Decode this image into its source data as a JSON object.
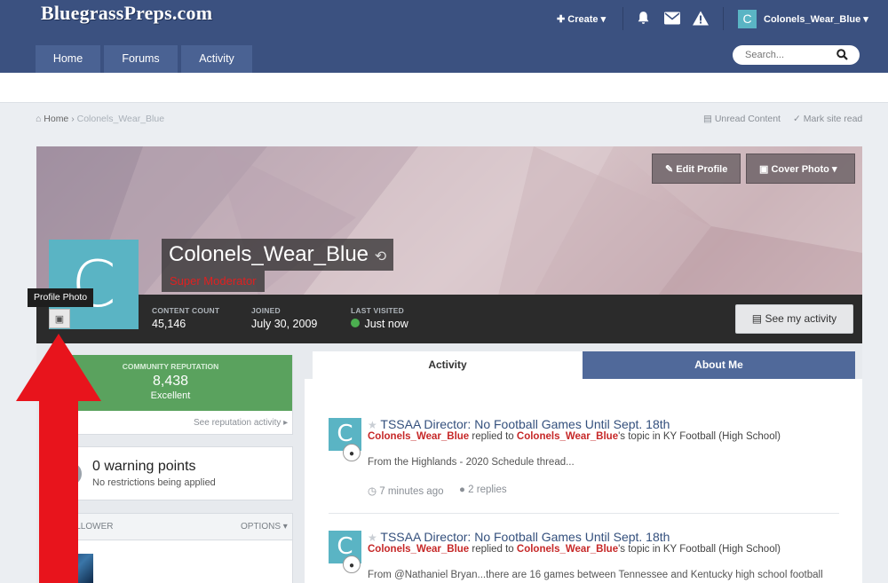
{
  "header": {
    "logo": "BluegrassPreps.com",
    "create_label": "Create",
    "username": "Colonels_Wear_Blue",
    "avatar_letter": "C",
    "nav": [
      "Home",
      "Forums",
      "Activity"
    ],
    "search_placeholder": "Search..."
  },
  "breadcrumb": {
    "home": "Home",
    "current": "Colonels_Wear_Blue",
    "unread": "Unread Content",
    "mark_read": "Mark site read"
  },
  "profile": {
    "name": "Colonels_Wear_Blue",
    "role": "Super Moderator",
    "avatar_letter": "C",
    "edit_profile": "Edit Profile",
    "cover_photo": "Cover Photo",
    "tooltip": "Profile Photo",
    "stats": [
      {
        "label": "CONTENT COUNT",
        "value": "45,146"
      },
      {
        "label": "JOINED",
        "value": "July 30, 2009"
      },
      {
        "label": "LAST VISITED",
        "value": "Just now"
      }
    ],
    "see_activity": "See my activity"
  },
  "sidebar": {
    "rep_label": "COMMUNITY REPUTATION",
    "rep_value": "8,438",
    "rep_level": "Excellent",
    "rep_link": "See reputation activity",
    "warn_title": "0 warning points",
    "warn_sub": "No restrictions being applied",
    "followers_label": "1 FOLLOWER",
    "options_label": "OPTIONS"
  },
  "tabs": [
    "Activity",
    "About Me"
  ],
  "feed": [
    {
      "avatar": "C",
      "title": "TSSAA Director: No Football Games Until Sept. 18th",
      "author": "Colonels_Wear_Blue",
      "verb": "replied to",
      "owner": "Colonels_Wear_Blue",
      "suffix": "'s topic in KY Football (High School)",
      "body": "From the Highlands - 2020 Schedule thread...",
      "time": "7 minutes ago",
      "replies": "2 replies"
    },
    {
      "avatar": "C",
      "title": "TSSAA Director: No Football Games Until Sept. 18th",
      "author": "Colonels_Wear_Blue",
      "verb": "replied to",
      "owner": "Colonels_Wear_Blue",
      "suffix": "'s topic in KY Football (High School)",
      "body": "From @Nathaniel Bryan...there are 16 games between Tennessee and Kentucky high school football"
    }
  ],
  "colors": {
    "header_bg": "#3b5180",
    "rep_green": "#5aa25e",
    "accent_red": "#c62828",
    "avatar_teal": "#5ab4c4"
  }
}
